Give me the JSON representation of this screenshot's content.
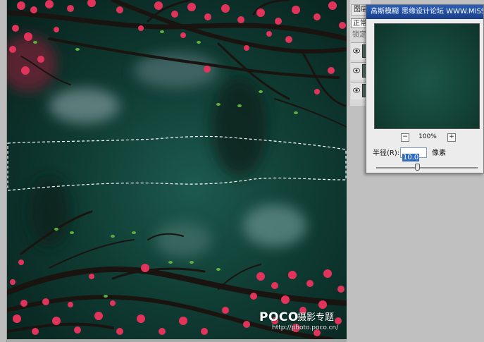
{
  "layers_panel": {
    "tab_label": "图层",
    "blend_mode": "正常",
    "lock_label": "锁定"
  },
  "dialog": {
    "title": "高斯模糊",
    "title_watermark": "思缘设计论坛 WWW.MISSYUAN.COM",
    "zoom_out_symbol": "−",
    "zoom_in_symbol": "+",
    "zoom_level": "100%",
    "radius_label": "半径(R):",
    "radius_value": "10.0",
    "radius_unit": "像素",
    "slider_fraction": 0.38
  },
  "watermark": {
    "logo": "POCO",
    "tagline": "摄影专题",
    "url": "http://photo.poco.cn/"
  },
  "colors": {
    "blossom": "#e2345a",
    "leaf": "#5fae3e",
    "branch": "#1a1411",
    "background_green": "#134a3f",
    "title_bar": "#2b5fb7"
  }
}
